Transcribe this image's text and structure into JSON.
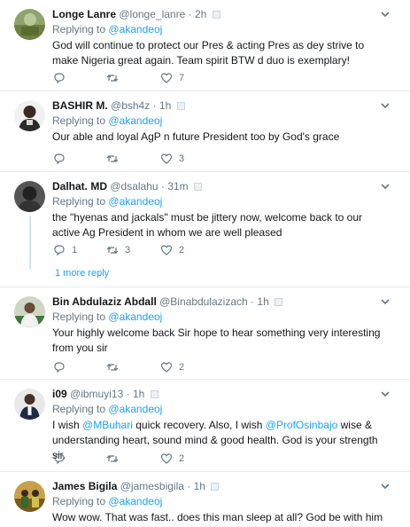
{
  "tweets": [
    {
      "name": "Longe Lanre",
      "handle": "@longe_lanre",
      "sep": "·",
      "time": "2h",
      "replying_prefix": "Replying to",
      "replying_to": "@akandeoj",
      "text": "God will continue to protect our Pres & acting Pres as dey strive to make Nigeria great again. Team spirit BTW d duo is exemplary!",
      "replies": "",
      "retweets": "",
      "likes": "7"
    },
    {
      "name": "BASHIR M.",
      "handle": "@bsh4z",
      "sep": "·",
      "time": "1h",
      "replying_prefix": "Replying to",
      "replying_to": "@akandeoj",
      "text": "Our able and loyal AgP n future President too by God's grace",
      "replies": "",
      "retweets": "",
      "likes": "3"
    },
    {
      "name": "Dalhat. MD",
      "handle": "@dsalahu",
      "sep": "·",
      "time": "31m",
      "replying_prefix": "Replying to",
      "replying_to": "@akandeoj",
      "text": "the \"hyenas and jackals\" must  be jittery now, welcome back to our active Ag President in whom we are well pleased",
      "replies": "1",
      "retweets": "3",
      "likes": "2",
      "more_replies": "1 more reply"
    },
    {
      "name": "Bin Abdulaziz Abdall",
      "handle": "@Binabdulazizach",
      "sep": "·",
      "time": "1h",
      "replying_prefix": "Replying to",
      "replying_to": "@akandeoj",
      "text": "Your highly welcome back Sir hope to hear something very interesting from you sir",
      "replies": "",
      "retweets": "",
      "likes": "2"
    },
    {
      "name": "i09",
      "handle": "@ibmuyi13",
      "sep": "·",
      "time": "1h",
      "replying_prefix": "Replying to",
      "replying_to": "@akandeoj",
      "text_parts": {
        "a": "I wish ",
        "m1": "@MBuhari",
        "b": " quick recovery. Also, I wish ",
        "m2": "@ProfOsinbajo",
        "c": " wise & understanding heart, sound mind & good health. God is your strength sir."
      },
      "replies": "",
      "retweets": "",
      "likes": "2"
    },
    {
      "name": "James Bigila",
      "handle": "@jamesbigila",
      "sep": "·",
      "time": "1h",
      "replying_prefix": "Replying to",
      "replying_to": "@akandeoj",
      "text": "Wow wow. That was fast.. does this man sleep at all? God be with him"
    }
  ],
  "icons": {
    "reply": "reply-icon",
    "retweet": "retweet-icon",
    "like": "heart-icon",
    "menu": "chevron-down-icon",
    "verified": "badge-icon"
  },
  "colors": {
    "link": "#1da1f2",
    "muted": "#657786",
    "text": "#14171a",
    "divider": "#e6ecf0",
    "thread": "#cce5f5"
  }
}
